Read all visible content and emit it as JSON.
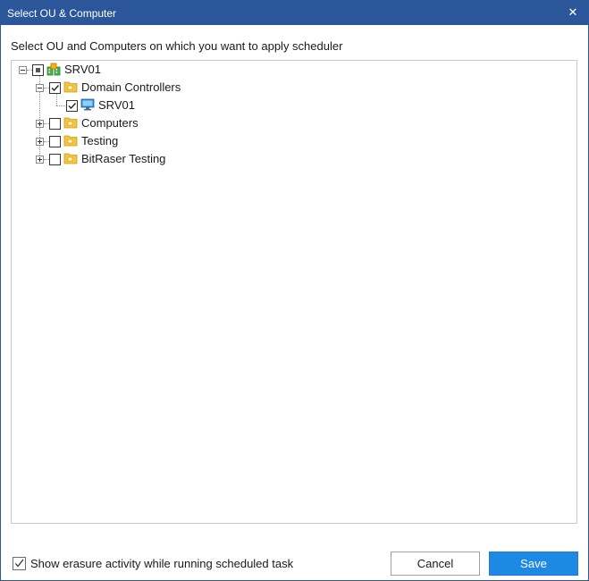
{
  "window": {
    "title": "Select OU & Computer",
    "close_glyph": "✕"
  },
  "instruction": "Select OU and Computers on which you want to apply scheduler",
  "tree": {
    "root": {
      "label": "SRV01",
      "icon": "domain-icon",
      "expanded": true,
      "check_state": "partial"
    },
    "nodes": [
      {
        "label": "Domain Controllers",
        "icon": "folder-icon",
        "expanded": true,
        "checked": true
      },
      {
        "label": "SRV01",
        "icon": "computer-icon",
        "checked": true
      },
      {
        "label": "Computers",
        "icon": "folder-icon",
        "expanded": false,
        "checked": false
      },
      {
        "label": "Testing",
        "icon": "folder-icon",
        "expanded": false,
        "checked": false
      },
      {
        "label": "BitRaser Testing",
        "icon": "folder-icon",
        "expanded": false,
        "checked": false
      }
    ]
  },
  "footer": {
    "show_activity_label": "Show erasure activity while running scheduled task",
    "show_activity_checked": true,
    "cancel_label": "Cancel",
    "save_label": "Save"
  },
  "colors": {
    "titlebar": "#2b579a",
    "save_button": "#1e88e5",
    "folder": "#f5c542",
    "monitor": "#2f8fdc"
  }
}
